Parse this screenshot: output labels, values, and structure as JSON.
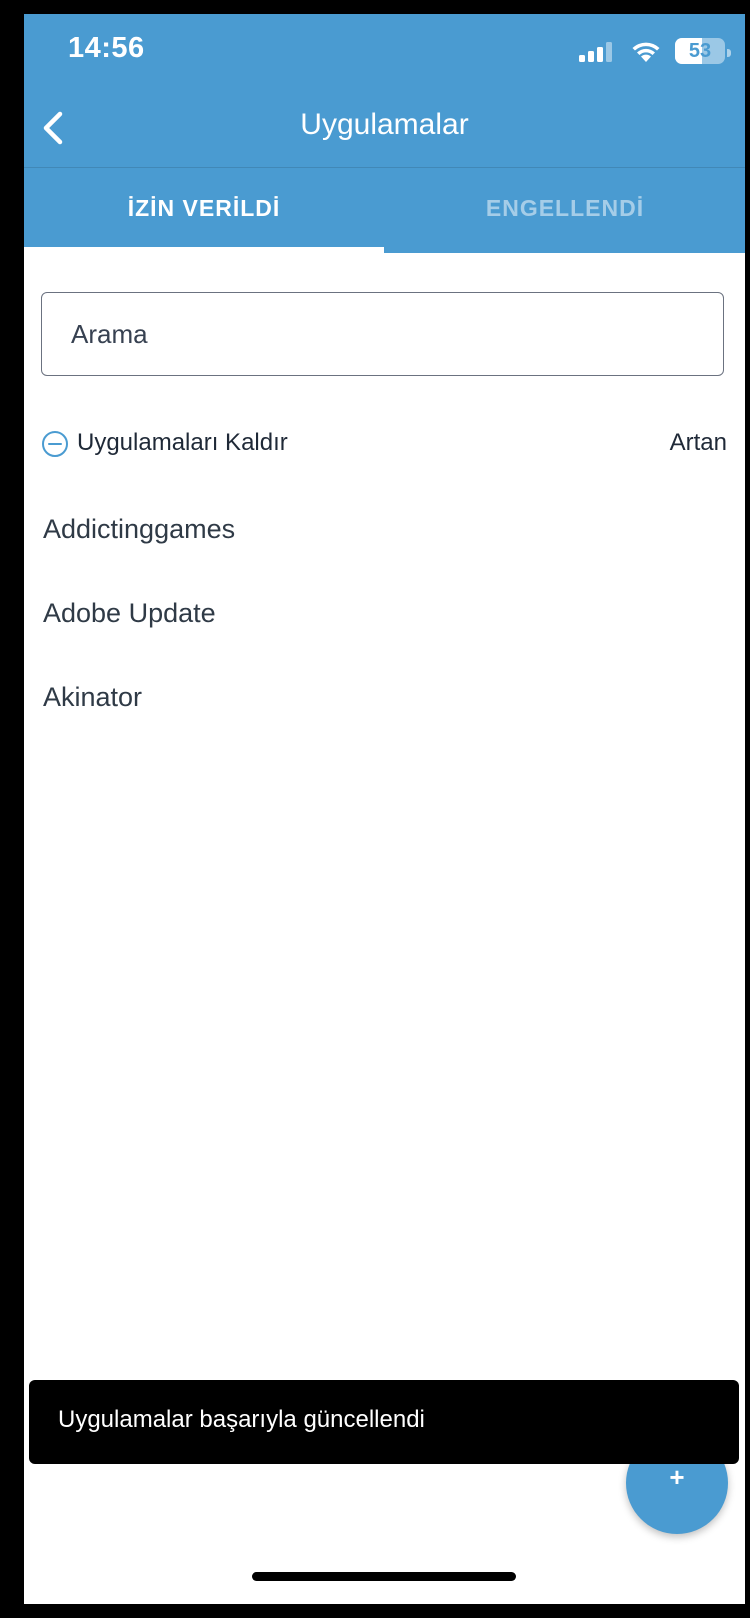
{
  "status_bar": {
    "time": "14:56",
    "battery": "53",
    "battery_level": 0.53,
    "icons": [
      "cellular-signal-icon",
      "wifi-icon",
      "battery-icon"
    ]
  },
  "header": {
    "title": "Uygulamalar",
    "back_icon": "chevron-left-icon",
    "background_color": "#4a9bd1"
  },
  "tabs": [
    {
      "label": "İZİN VERİLDİ",
      "active": true
    },
    {
      "label": "ENGELLENDİ",
      "active": false
    }
  ],
  "search": {
    "placeholder": "Arama"
  },
  "actions": {
    "remove_label": "Uygulamaları Kaldır",
    "remove_icon": "minus-circle-icon",
    "sort_label": "Artan"
  },
  "apps": [
    {
      "name": "Addictinggames"
    },
    {
      "name": "Adobe Update"
    },
    {
      "name": "Akinator"
    }
  ],
  "toast": {
    "message": "Uygulamalar başarıyla güncellendi"
  },
  "fab": {
    "label": "+",
    "icon": "plus-icon"
  }
}
